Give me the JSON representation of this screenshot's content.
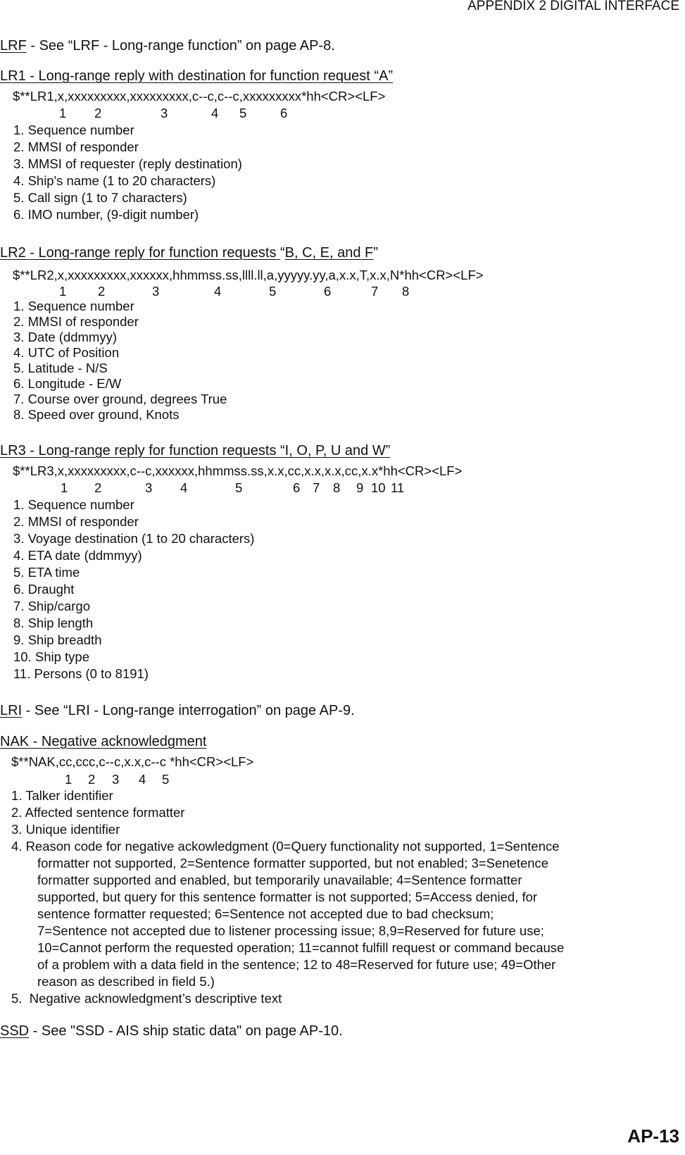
{
  "header": {
    "title": "APPENDIX 2 DIGITAL INTERFACE"
  },
  "footer": {
    "page_number": "AP-13"
  },
  "lrf": {
    "code": "LRF",
    "text": " - See “LRF - Long-range function” on page AP-8."
  },
  "lr1": {
    "title": "LR1 - Long-range reply with destination for function request “A”",
    "format": "$**LR1,x,xxxxxxxxx,xxxxxxxxx,c--c,c--c,xxxxxxxxx*hh<CR><LF>",
    "field_numbers": [
      "1",
      "2",
      "3",
      "4",
      "5",
      "6"
    ],
    "items": [
      "1. Sequence number",
      "2. MMSI of responder",
      "3. MMSI of requester (reply destination)",
      "4. Ship's name (1 to 20 characters)",
      "5. Call sign (1 to 7 characters)",
      "6. IMO number, (9-digit number)"
    ]
  },
  "lr2": {
    "title_part1": "LR2 - Long-range reply for function requests ",
    "title_part2": "“",
    "title_part3": "B, C, E, and F",
    "title_part4": "”",
    "format": "$**LR2,x,xxxxxxxxx,xxxxxx,hhmmss.ss,llll.ll,a,yyyyy.yy,a,x.x,T,x.x,N*hh<CR><LF>",
    "field_numbers": [
      "1",
      "2",
      "3",
      "4",
      "5",
      "6",
      "7",
      "8"
    ],
    "items": [
      "1. Sequence number",
      "2. MMSI of responder",
      "3. Date (ddmmyy)",
      "4. UTC of Position",
      "5. Latitude - N/S",
      "6. Longitude - E/W",
      "7. Course over ground, degrees True",
      "8. Speed over ground, Knots"
    ]
  },
  "lr3": {
    "title": "LR3 - Long-range reply for function requests “I, O, P, U and W”",
    "format": "$**LR3,x,xxxxxxxxx,c--c,xxxxxx,hhmmss.ss,x.x,cc,x.x,x.x,cc,x.x*hh<CR><LF>",
    "field_numbers": [
      "1",
      "2",
      "3",
      "4",
      "5",
      "6",
      "7",
      "8",
      "9",
      "10",
      "11"
    ],
    "items": [
      "1. Sequence number",
      "2. MMSI of responder",
      "3. Voyage destination (1 to 20 characters)",
      "4. ETA date (ddmmyy)",
      "5. ETA time",
      "6. Draught",
      "7. Ship/cargo",
      "8. Ship length",
      "9. Ship breadth",
      "10. Ship type",
      "11. Persons (0 to 8191)"
    ]
  },
  "lri": {
    "code": "LRI",
    "text": " - See “LRI - Long-range interrogation” on page AP-9."
  },
  "nak": {
    "title": "NAK - Negative acknowledgment",
    "format": "$**NAK,cc,ccc,c--c,x.x,c--c *hh<CR><LF>",
    "field_numbers": [
      "1",
      "2",
      "3",
      "4",
      "5"
    ],
    "items": [
      "1. Talker identifier",
      "2. Affected sentence formatter",
      "3. Unique identifier"
    ],
    "item4_first": "4. Reason code for negative ackowledgment (0=Query functionality not supported, 1=Sentence",
    "item4_cont": [
      "formatter not supported, 2=Sentence formatter supported, but not enabled; 3=Senetence",
      "formatter supported and enabled, but temporarily unavailable; 4=Sentence formatter",
      "supported, but query for this sentence formatter is not supported; 5=Access denied, for",
      "sentence formatter requested; 6=Sentence not accepted due to bad checksum;",
      "7=Sentence not accepted due to listener processing issue; 8,9=Reserved for future use;",
      "10=Cannot perform the requested operation; 11=cannot fulfill request or command because",
      "of a problem with a data field in the sentence; 12 to 48=Reserved for future use; 49=Other",
      "reason as described in field 5.)"
    ],
    "item5": "5.  Negative acknowledgment’s descriptive text"
  },
  "ssd": {
    "code": "SSD",
    "text": " - See \"SSD - AIS ship static data\" on page AP-10."
  }
}
